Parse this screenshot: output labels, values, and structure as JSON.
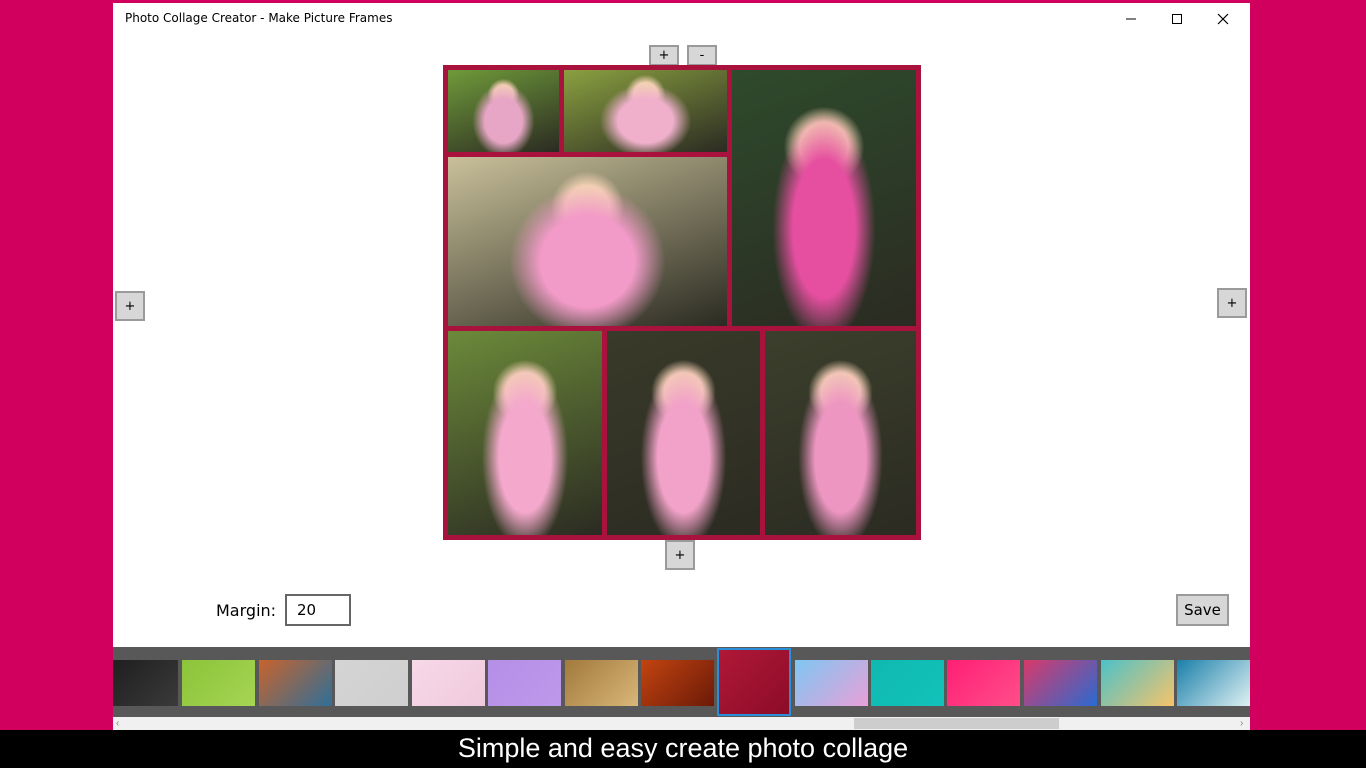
{
  "window": {
    "title": "Photo Collage Creator - Make Picture Frames"
  },
  "controls": {
    "top_add": "+",
    "top_remove": "-",
    "left_add": "+",
    "right_add": "+",
    "bottom_add": "+"
  },
  "collage": {
    "border_color": "#a8123c",
    "photos": [
      {
        "name": "photo-girl-on-lawn",
        "colors": [
          "#6f9a3a",
          "#e8a6c6"
        ]
      },
      {
        "name": "photo-girl-lying-in-grass",
        "colors": [
          "#8aa040",
          "#f0b0cc"
        ]
      },
      {
        "name": "photo-girl-by-tree-trunk",
        "colors": [
          "#2e4a2c",
          "#e64fa0"
        ]
      },
      {
        "name": "photo-girl-in-park",
        "colors": [
          "#c9c09a",
          "#f29ac8"
        ]
      },
      {
        "name": "photo-girl-smiling-closeup",
        "colors": [
          "#6c8a3a",
          "#f4a8cc"
        ]
      },
      {
        "name": "photo-girl-among-vines",
        "colors": [
          "#3a3a2a",
          "#f2a2c8"
        ]
      },
      {
        "name": "photo-girl-arms-out",
        "colors": [
          "#3c3f2c",
          "#ee96c2"
        ]
      }
    ]
  },
  "settings": {
    "margin_label": "Margin:",
    "margin_value": "20",
    "save_label": "Save"
  },
  "backgrounds": [
    {
      "name": "background-dark",
      "color": "#1f1f1f",
      "color2": "#3a3a3a"
    },
    {
      "name": "background-green",
      "color": "#8bc43a",
      "color2": "#a6d454"
    },
    {
      "name": "background-bokeh",
      "color": "#c8632c",
      "color2": "#2f6f98"
    },
    {
      "name": "background-light-gray",
      "color": "#d4d4d4",
      "color2": "#cfcfcf"
    },
    {
      "name": "background-pink-wood",
      "color": "#f7d9e8",
      "color2": "#efc9dc"
    },
    {
      "name": "background-lavender",
      "color": "#b58fe6",
      "color2": "#bd98ea"
    },
    {
      "name": "background-parchment",
      "color": "#a17a3c",
      "color2": "#d9b679"
    },
    {
      "name": "background-rust",
      "color": "#c24410",
      "color2": "#6b1a08"
    },
    {
      "name": "background-red-glitter",
      "color": "#b01838",
      "color2": "#8c0c28",
      "selected": true
    },
    {
      "name": "background-rainbow-blur",
      "color": "#7fc6f2",
      "color2": "#e8a0d8"
    },
    {
      "name": "background-teal",
      "color": "#10b9b2",
      "color2": "#12c2ba"
    },
    {
      "name": "background-hot-pink",
      "color": "#ff1f74",
      "color2": "#ff4e8a"
    },
    {
      "name": "background-color-swirl",
      "color": "#d83a6a",
      "color2": "#2a6ad0"
    },
    {
      "name": "background-pastel-gradient",
      "color": "#4cc2c8",
      "color2": "#f6c36a"
    },
    {
      "name": "background-light-blue",
      "color": "#1a7faa",
      "color2": "#dff1f2"
    }
  ],
  "caption": "Simple and easy create photo collage"
}
